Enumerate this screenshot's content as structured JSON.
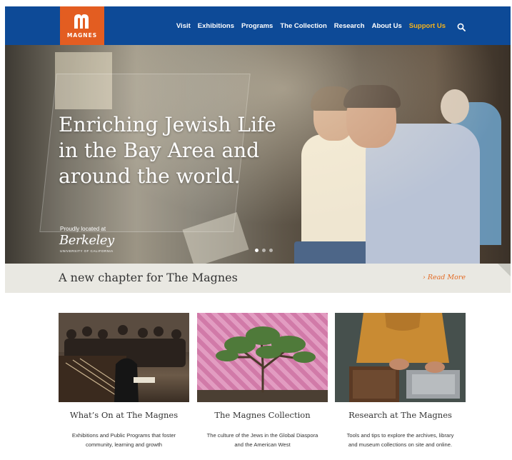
{
  "header": {
    "logo_text": "MAGNES",
    "nav": [
      "Visit",
      "Exhibitions",
      "Programs",
      "The Collection",
      "Research",
      "About Us",
      "Support Us"
    ],
    "colors": {
      "background": "#0d4a97",
      "logo": "#e35d21",
      "support": "#f5b21b"
    },
    "search_icon": "search-icon"
  },
  "hero": {
    "title": "Enriching Jewish Life in the Bay Area and around the world.",
    "located_label": "Proudly located at",
    "berkeley_label": "Berkeley",
    "berkeley_sub": "UNIVERSITY OF CALIFORNIA",
    "slides_total": 3,
    "slide_active": 1
  },
  "banner": {
    "title": "A new chapter for The Magnes",
    "read_more": "› Read More",
    "accent": "#e36b25"
  },
  "cards": [
    {
      "title": "What’s On at The Magnes",
      "desc_line1": "Exhibitions and Public Programs that foster",
      "desc_line2": "community, learning and growth"
    },
    {
      "title": "The Magnes Collection",
      "desc_line1": "The culture of the Jews in the Global Diaspora",
      "desc_line2": "and the American West"
    },
    {
      "title": "Research at The Magnes",
      "desc_line1": "Tools and tips to explore the archives, library",
      "desc_line2": "and museum collections on site and online."
    }
  ]
}
